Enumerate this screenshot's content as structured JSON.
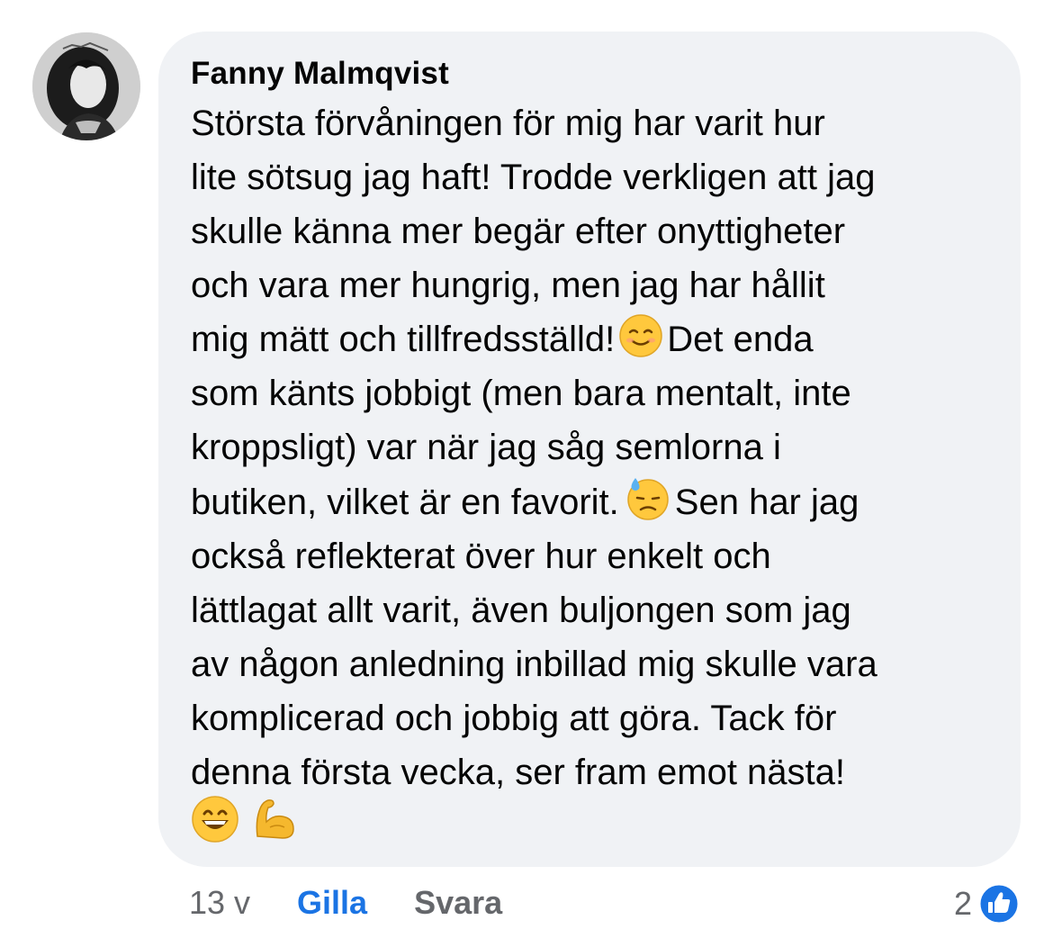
{
  "comment": {
    "author": "Fanny Malmqvist",
    "lines": [
      "Största förvåningen för mig har varit hur",
      "lite sötsug jag haft! Trodde verkligen att jag",
      "skulle känna mer begär efter onyttigheter",
      "och vara mer hungrig, men jag har hållit"
    ],
    "line5_before": "mig mätt och tillfredsställd!",
    "line5_after": "Det enda",
    "line6": "som känts jobbigt (men bara mentalt, inte",
    "line7": "kroppsligt) var när jag såg semlorna i",
    "line8_before": "butiken, vilket är en favorit.",
    "line8_after": "Sen har jag",
    "lines_rest": [
      "också reflekterat över hur enkelt och",
      "lättlagat allt varit, även buljongen som jag",
      "av någon anledning inbillad mig skulle vara",
      "komplicerad och jobbig att göra. Tack för",
      "denna första vecka, ser fram emot nästa!"
    ],
    "emojis": [
      "smiling-face-icon",
      "downcast-sweat-face-icon",
      "grinning-face-icon",
      "flexed-biceps-icon"
    ]
  },
  "actions": {
    "time": "13 v",
    "like": "Gilla",
    "reply": "Svara"
  },
  "reactions": {
    "count": "2",
    "icon": "like-thumb-icon",
    "color": "#1b74e4"
  },
  "colors": {
    "bubble": "#f0f2f5",
    "text": "#050505",
    "secondary": "#65676b",
    "accent": "#1b74e4"
  }
}
